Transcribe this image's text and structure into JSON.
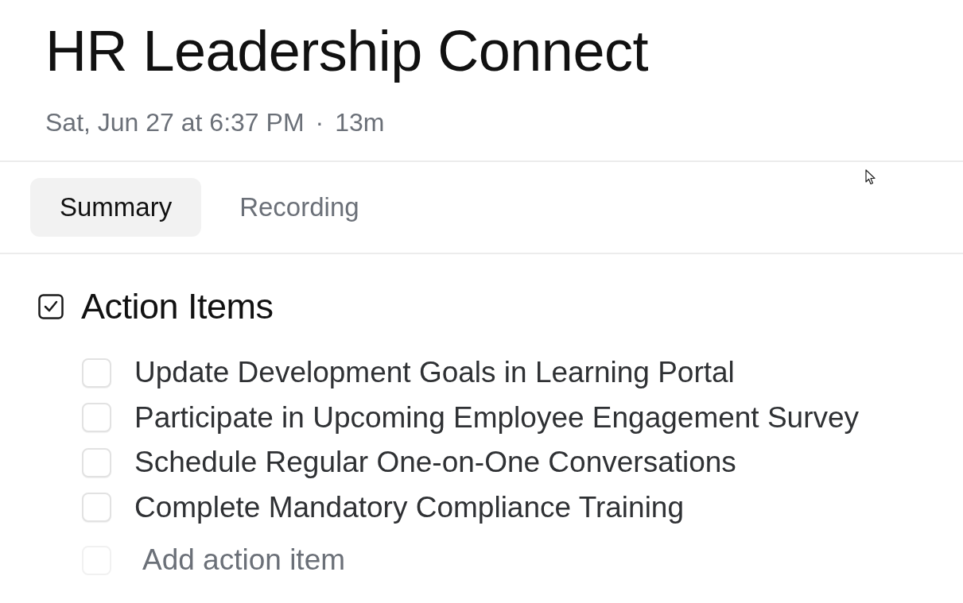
{
  "meeting": {
    "title": "HR Leadership Connect",
    "date": "Sat, Jun 27 at 6:37 PM",
    "separator": "·",
    "duration": "13m"
  },
  "tabs": [
    {
      "label": "Summary",
      "selected": true
    },
    {
      "label": "Recording",
      "selected": false
    }
  ],
  "action_items": {
    "heading": "Action Items",
    "items": [
      {
        "text": "Update Development Goals in Learning Portal",
        "checked": false
      },
      {
        "text": "Participate in Upcoming Employee Engagement Survey",
        "checked": false
      },
      {
        "text": "Schedule Regular One-on-One Conversations",
        "checked": false
      },
      {
        "text": "Complete Mandatory Compliance Training",
        "checked": false
      }
    ],
    "add_item": {
      "placeholder": "Add action item"
    }
  }
}
